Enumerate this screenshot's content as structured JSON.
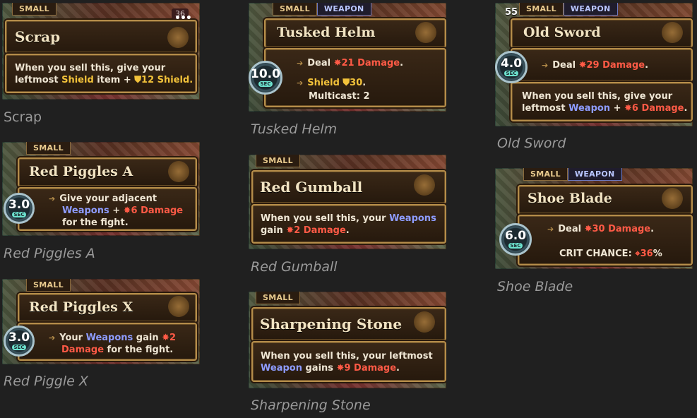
{
  "items": [
    {
      "id": "scrap",
      "tags": [
        "SMALL"
      ],
      "title": "Scrap",
      "badge": "36",
      "caption": "Scrap",
      "desc": [
        {
          "t": "When you sell this, give your"
        },
        {
          "t": "leftmost "
        },
        {
          "t": "Shield",
          "k": "shield"
        },
        {
          "t": " item + "
        },
        {
          "t": "⛊12 Shield.",
          "k": "shield"
        }
      ]
    },
    {
      "id": "red-piggles-a",
      "tags": [
        "SMALL"
      ],
      "title": "Red Piggles A",
      "cooldown": "3.0",
      "caption": "Red Piggles A"
    },
    {
      "id": "red-piggles-x",
      "tags": [
        "SMALL"
      ],
      "title": "Red Piggles X",
      "cooldown": "3.0",
      "caption": "Red Piggle X"
    },
    {
      "id": "tusked-helm",
      "tags": [
        "SMALL",
        "WEAPON"
      ],
      "title": "Tusked Helm",
      "cooldown": "10.0",
      "caption": "Tusked Helm"
    },
    {
      "id": "red-gumball",
      "tags": [
        "SMALL"
      ],
      "title": "Red Gumball",
      "caption": "Red Gumball"
    },
    {
      "id": "sharpening-stone",
      "tags": [
        "SMALL"
      ],
      "title": "Sharpening Stone",
      "caption": "Sharpening Stone"
    },
    {
      "id": "old-sword",
      "tags": [
        "SMALL",
        "WEAPON"
      ],
      "title": "Old Sword",
      "cooldown": "4.0",
      "level": "55",
      "caption": "Old Sword"
    },
    {
      "id": "shoe-blade",
      "tags": [
        "SMALL",
        "WEAPON"
      ],
      "title": "Shoe Blade",
      "cooldown": "6.0",
      "caption": "Shoe Blade"
    }
  ],
  "text": {
    "sec": "SEC",
    "scrap_l1": "When you sell this, give your",
    "scrap_l2a": "leftmost ",
    "scrap_l2b": "Shield",
    "scrap_l2c": " item + ",
    "scrap_l2d": "⛊12 Shield.",
    "rpa_l1": "Give your adjacent",
    "rpa_l2a": "Weapons",
    "rpa_l2b": " + ",
    "rpa_l2c": "✸6 Damage",
    "rpa_l3": "for the fight.",
    "rpx_l1a": "Your ",
    "rpx_l1b": "Weapons",
    "rpx_l1c": " gain ",
    "rpx_l1d": "✸2",
    "rpx_l2a": "Damage",
    "rpx_l2b": " for the fight.",
    "th_l1a": "Deal ",
    "th_l1b": "✸21 Damage",
    "th_l1c": ".",
    "th_l2a": "Shield ",
    "th_l2b": "⛊30",
    "th_l2c": ".",
    "th_l3": "Multicast: 2",
    "rg_l1a": "When you sell this, your ",
    "rg_l1b": "Weapons",
    "rg_l2a": "gain ",
    "rg_l2b": "✸2 Damage",
    "rg_l2c": ".",
    "ss_l1": "When you sell this, your leftmost",
    "ss_l2a": "Weapon",
    "ss_l2b": " gains ",
    "ss_l2c": "✸9 Damage",
    "ss_l2d": ".",
    "os_l1a": "Deal ",
    "os_l1b": "✸29 Damage",
    "os_l1c": ".",
    "os_l2": "When you sell this, give your",
    "os_l3a": "leftmost ",
    "os_l3b": "Weapon",
    "os_l3c": " + ",
    "os_l3d": "✸6 Damage",
    "os_l3e": ".",
    "sb_l1a": "Deal ",
    "sb_l1b": "✸30 Damage",
    "sb_l1c": ".",
    "sb_l2a": "CRIT CHANCE: ",
    "sb_l2b": "⌖36",
    "sb_l2c": "%"
  },
  "colors": {
    "background": "#202020",
    "shield": "#f2c23a",
    "weapon": "#8e9cff",
    "damage": "#ff5a46",
    "caption": "#9a9a9a"
  }
}
